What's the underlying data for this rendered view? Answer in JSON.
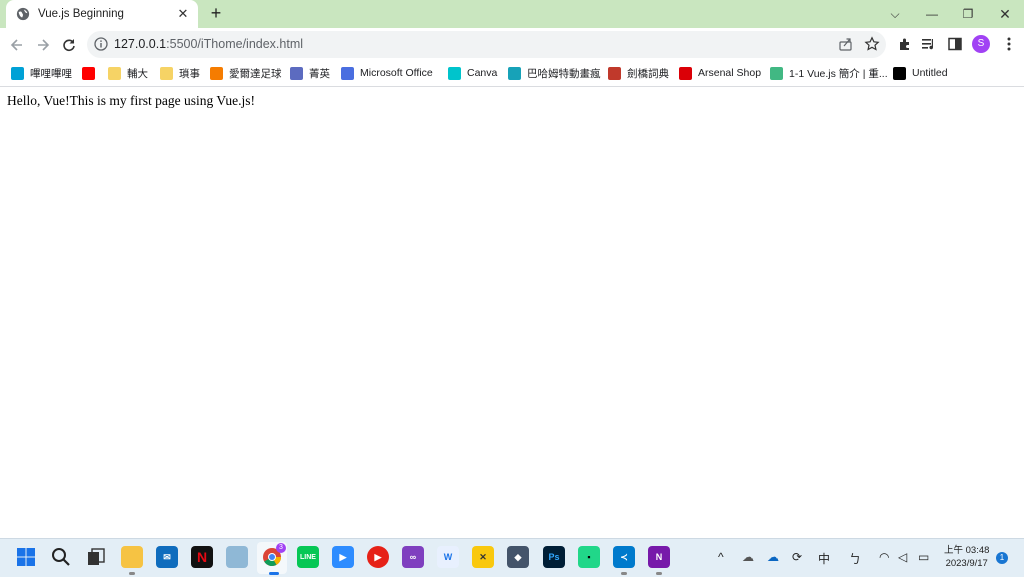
{
  "browser": {
    "tab": {
      "title": "Vue.js Beginning",
      "close": "✕"
    },
    "new_tab": "+",
    "window": {
      "minimize": "—",
      "restore": "❐",
      "close": "✕",
      "dropdown": "⌵"
    },
    "address": {
      "host": "127.0.0.1",
      "rest": ":5500/iThome/index.html"
    },
    "profile_initial": "S"
  },
  "bookmarks": [
    {
      "label": "嗶哩嗶哩",
      "icon": "bilibili-icon",
      "color": "#00a1d6"
    },
    {
      "label": "",
      "icon": "youtube-icon",
      "color": "#ff0000"
    },
    {
      "label": "輔大",
      "icon": "folder-icon",
      "color": "#f6d365"
    },
    {
      "label": "瑣事",
      "icon": "folder-icon",
      "color": "#f6d365"
    },
    {
      "label": "愛爾達足球",
      "icon": "elta-icon",
      "color": "#f57c00"
    },
    {
      "label": "菁英",
      "icon": "jingying-icon",
      "color": "#5c6bc0"
    },
    {
      "label": "Microsoft Office",
      "icon": "office-icon",
      "color": "#4a6ee0"
    },
    {
      "label": "Canva",
      "icon": "canva-icon",
      "color": "#00c4cc"
    },
    {
      "label": "巴哈姆特動畫瘋",
      "icon": "bahamut-icon",
      "color": "#17a2b8"
    },
    {
      "label": "劍橋詞典",
      "icon": "cambridge-icon",
      "color": "#c0392b"
    },
    {
      "label": "Arsenal Shop",
      "icon": "arsenal-icon",
      "color": "#db0007"
    },
    {
      "label": "1-1 Vue.js 簡介 | 重...",
      "icon": "vue-icon",
      "color": "#41b883"
    },
    {
      "label": "Untitled",
      "icon": "notion-icon",
      "color": "#000000"
    }
  ],
  "page": {
    "text": "Hello, Vue!This is my first page using Vue.js!"
  },
  "taskbar": {
    "chrome_badge": "3",
    "tray_ime": "中",
    "time": "上午 03:48",
    "date": "2023/9/17",
    "notifications": "1"
  }
}
